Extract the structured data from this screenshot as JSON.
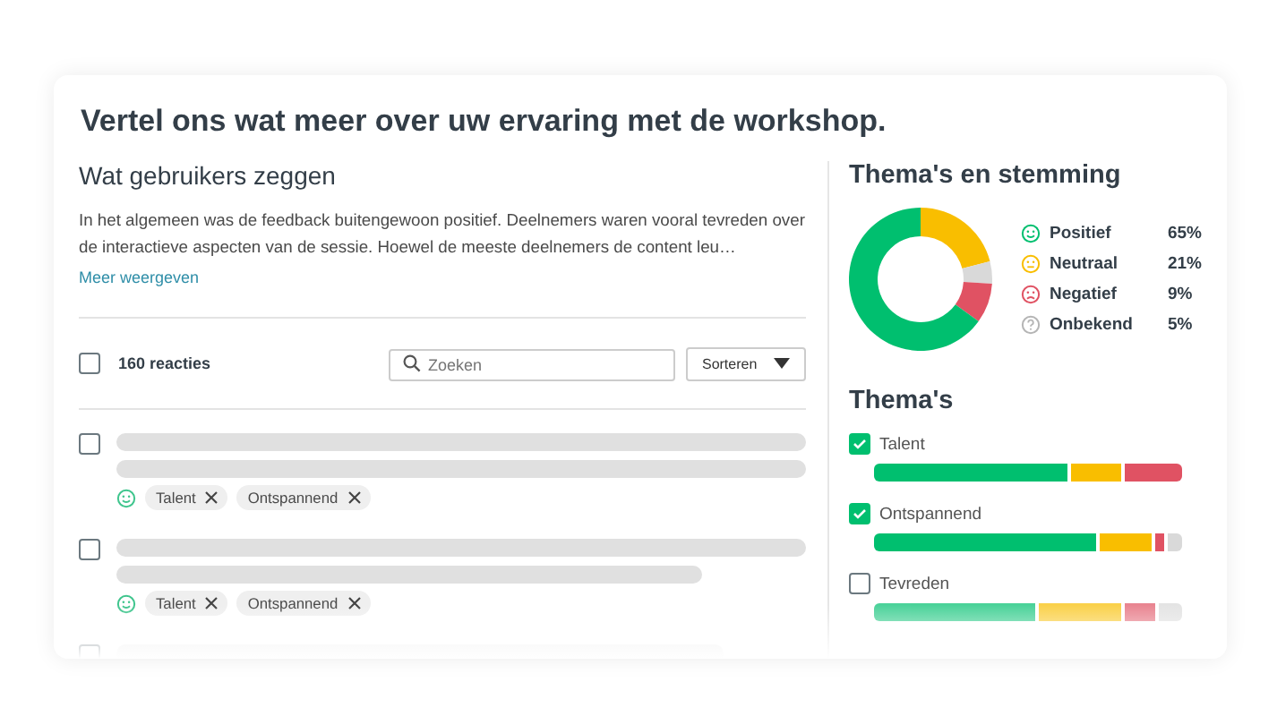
{
  "title": "Vertel ons wat meer over uw ervaring met de workshop.",
  "summary": {
    "heading": "Wat gebruikers zeggen",
    "text": "In het algemeen was de feedback buitengewoon positief. Deelnemers waren vooral tevreden over de interactieve aspecten van de sessie. Hoewel de meeste deelnemers de content leu…",
    "link": "Meer weergeven"
  },
  "toolbar": {
    "select_all": {
      "checked": false
    },
    "count": "160 reacties",
    "search": {
      "placeholder": "Zoeken"
    },
    "sort": {
      "label": "Sorteren"
    }
  },
  "responses": [
    {
      "checked": false,
      "tags": [
        {
          "label": "Talent"
        },
        {
          "label": "Ontspannend"
        }
      ]
    },
    {
      "checked": false,
      "tags": [
        {
          "label": "Talent"
        },
        {
          "label": "Ontspannend"
        }
      ]
    },
    {
      "checked": false
    }
  ],
  "sentiment_panel": {
    "heading": "Thema's en stemming",
    "chart_data": {
      "type": "donut",
      "categories": [
        "Positief",
        "Neutraal",
        "Negatief",
        "Onbekend"
      ],
      "values": [
        65,
        21,
        9,
        5
      ],
      "colors": [
        "#00bf6f",
        "#f9be00",
        "#e05263",
        "#d9d9d9"
      ]
    },
    "legend": [
      {
        "kind": "positive",
        "value": "65%",
        "color": "#00bf6f"
      },
      {
        "kind": "neutral",
        "value": "21%",
        "color": "#f9be00"
      },
      {
        "kind": "negative",
        "value": "9%",
        "color": "#e05263"
      },
      {
        "kind": "unknown",
        "value": "5%",
        "color": "#b5b5b5"
      }
    ]
  },
  "themes": {
    "heading": "Thema's",
    "items": [
      {
        "label": "Talent",
        "checked": true
      },
      {
        "label": "Ontspannend",
        "checked": true
      },
      {
        "label": "Tevreden",
        "checked": false
      }
    ]
  }
}
